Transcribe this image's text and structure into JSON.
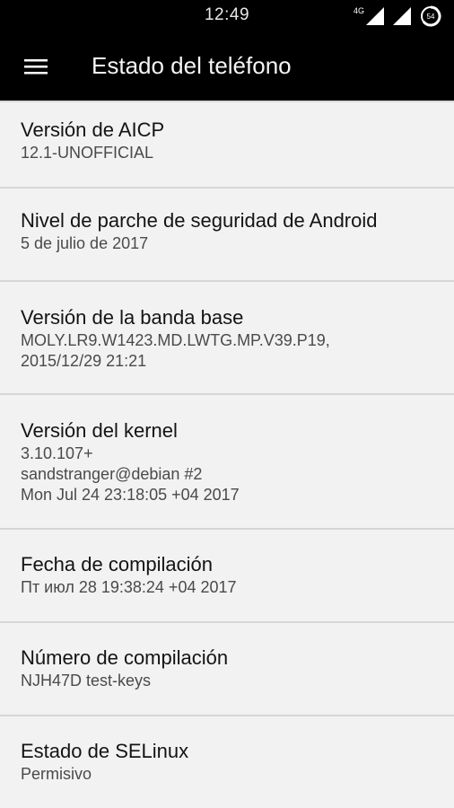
{
  "status_bar": {
    "time": "12:49",
    "network_type": "4G",
    "battery_level": "54"
  },
  "app_bar": {
    "title": "Estado del teléfono"
  },
  "items": [
    {
      "title": "Versión de AICP",
      "value": "12.1-UNOFFICIAL"
    },
    {
      "title": "Nivel de parche de seguridad de Android",
      "value": "5 de julio de 2017"
    },
    {
      "title": "Versión de la banda base",
      "value": "MOLY.LR9.W1423.MD.LWTG.MP.V39.P19,\n2015/12/29 21:21"
    },
    {
      "title": "Versión del kernel",
      "value": "3.10.107+\nsandstranger@debian #2\nMon Jul 24 23:18:05 +04 2017"
    },
    {
      "title": "Fecha de compilación",
      "value": "Пт июл 28 19:38:24 +04 2017"
    },
    {
      "title": "Número de compilación",
      "value": "NJH47D test-keys"
    },
    {
      "title": "Estado de SELinux",
      "value": "Permisivo"
    }
  ]
}
